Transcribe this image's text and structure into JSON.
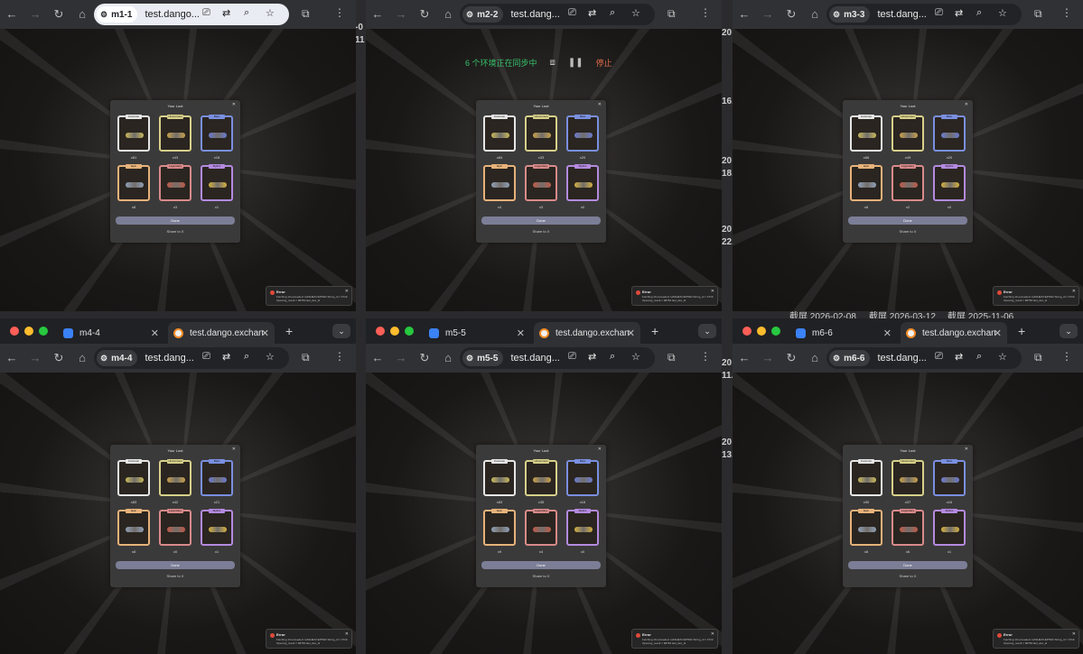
{
  "desktop": {
    "gap_text": [
      "-0",
      "11",
      "20",
      "16.",
      "20",
      "18.",
      "20",
      "22.",
      "20",
      "12",
      "20",
      "11.",
      "20",
      "13.",
      "20",
      "23.",
      "20",
      "13."
    ],
    "screenshot_labels": [
      "截屏 2026-02-08",
      "截屏 2026-03-12",
      "截屏 2025-11-06"
    ]
  },
  "windows": [
    {
      "profile_chip": "m1-1",
      "host": "test.dango...",
      "has_tabstrip": false,
      "loot": {
        "title": "Your Loot",
        "counts": [
          "x81",
          "x43",
          "x18",
          "x8",
          "x3",
          "x1"
        ],
        "done": "Done",
        "share": "Share to X"
      },
      "error": {
        "title": "Error",
        "message": "Fetching 10 exceeded: HASHEXCEPTED String_id = 3719 Opening_result = 98784 last_dex_id"
      }
    },
    {
      "profile_chip": "m2-2",
      "host": "test.dang...",
      "has_tabstrip": false,
      "sync": {
        "status": "6 个环境正在同步中",
        "stop": "停止"
      },
      "loot": {
        "title": "Your Loot",
        "counts": [
          "x84",
          "x33",
          "x20",
          "x4",
          "x3",
          "x0"
        ],
        "done": "Done",
        "share": "Share to X"
      },
      "error": {
        "title": "Error",
        "message": "Fetching 10 exceeded: HASHEXCEPTED String_id = 3719 Opening_result = 98784 last_dex_id"
      }
    },
    {
      "profile_chip": "m3-3",
      "host": "test.dang...",
      "has_tabstrip": false,
      "loot": {
        "title": "Your Loot",
        "counts": [
          "x66",
          "x49",
          "x20",
          "x8",
          "x2",
          "x0"
        ],
        "done": "Done",
        "share": "Share to X"
      },
      "error": {
        "title": "Error",
        "message": "Fetching 10 exceeded: HASHEXCEPTED String_id = 3719 Opening_result = 98784 last_dex_id"
      }
    },
    {
      "profile_chip": "m4-4",
      "host": "test.dang...",
      "has_tabstrip": true,
      "tab1": "m4-4",
      "tab2": "test.dango.exchan",
      "loot": {
        "title": "Your Loot",
        "counts": [
          "x83",
          "x42",
          "x21",
          "x8",
          "x0",
          "x1"
        ],
        "done": "Done",
        "share": "Share to X"
      },
      "error": {
        "title": "Error",
        "message": "Fetching 10 exceeded: HASHEXCEPTED String_id = 3719 Opening_result = 98784 last_dex_id"
      }
    },
    {
      "profile_chip": "m5-5",
      "host": "test.dang...",
      "has_tabstrip": true,
      "tab1": "m5-5",
      "tab2": "test.dango.exchan",
      "loot": {
        "title": "Your Loot",
        "counts": [
          "x83",
          "x35",
          "x16",
          "x9",
          "x4",
          "x0"
        ],
        "done": "Done",
        "share": "Share to X"
      },
      "error": {
        "title": "Error",
        "message": "Fetching 10 exceeded: HASHEXCEPTED String_id = 3719 Opening_result = 98784 last_dex_id"
      }
    },
    {
      "profile_chip": "m6-6",
      "host": "test.dang...",
      "has_tabstrip": true,
      "tab1": "m6-6",
      "tab2": "test.dango.exchan",
      "loot": {
        "title": "Your Loot",
        "counts": [
          "x90",
          "x37",
          "x16",
          "x8",
          "x6",
          "x1"
        ],
        "done": "Done",
        "share": "Share to X"
      },
      "error": {
        "title": "Error",
        "message": "Fetching 10 exceeded: HASHEXCEPTED String_id = 3719 Opening_result = 98784 last_dex_id"
      }
    }
  ],
  "card_tags": [
    "Common",
    "Uncommon",
    "Rare",
    "Epic",
    "Legendary",
    "Mythic"
  ],
  "card_colors": {
    "common": "#e6e6e6",
    "uncommon": "#d7d08a",
    "rare": "#7a8fe0",
    "epic": "#e7b27a",
    "legendary": "#d98a8a",
    "mythic": "#b48ae0"
  },
  "icons": {
    "back": "arrow-left-icon",
    "forward": "arrow-right-icon",
    "reload": "reload-icon",
    "home": "home-icon",
    "ext": "puzzle-icon",
    "menu": "kebab-icon"
  }
}
